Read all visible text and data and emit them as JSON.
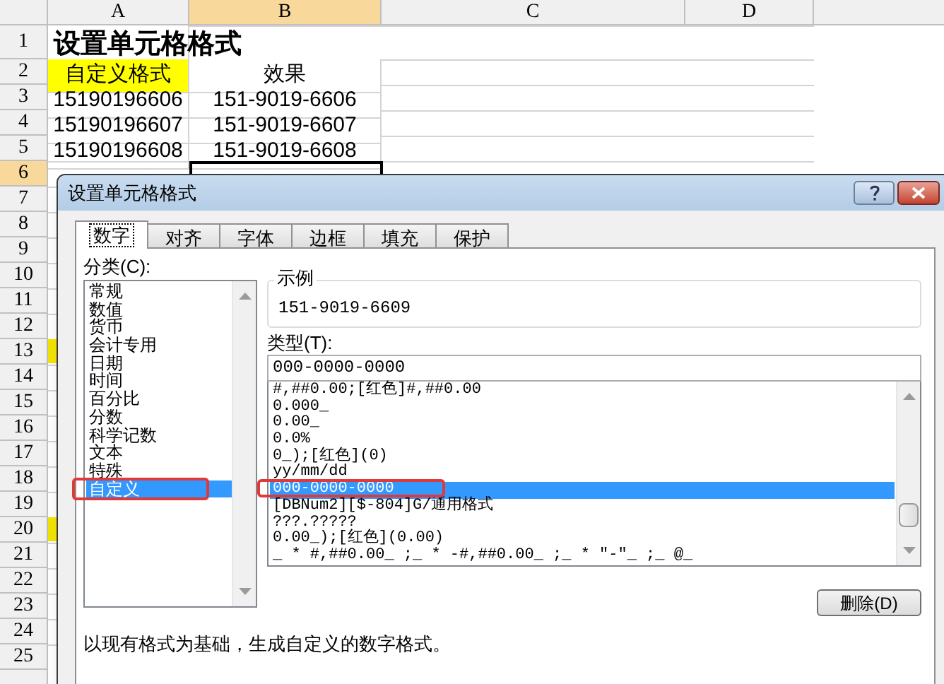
{
  "sheet": {
    "columns": [
      {
        "label": "A",
        "selected": false
      },
      {
        "label": "B",
        "selected": true
      },
      {
        "label": "C",
        "selected": false
      },
      {
        "label": "D",
        "selected": false
      }
    ],
    "rows": [
      {
        "number": "1",
        "selected": false,
        "marked": false,
        "cells": [
          "设置单元格格式"
        ],
        "kind": "title"
      },
      {
        "number": "2",
        "selected": false,
        "marked": false,
        "cells": [
          "自定义格式",
          "效果"
        ],
        "kind": "header"
      },
      {
        "number": "3",
        "selected": false,
        "marked": false,
        "cells": [
          "15190196606",
          "151-9019-6606"
        ],
        "kind": "data"
      },
      {
        "number": "4",
        "selected": false,
        "marked": false,
        "cells": [
          "15190196607",
          "151-9019-6607"
        ],
        "kind": "data"
      },
      {
        "number": "5",
        "selected": false,
        "marked": false,
        "cells": [
          "15190196608",
          "151-9019-6608"
        ],
        "kind": "data"
      },
      {
        "number": "6",
        "selected": true,
        "marked": false,
        "cells": [],
        "kind": "data"
      },
      {
        "number": "7",
        "selected": false,
        "marked": false,
        "cells": [],
        "kind": "data"
      },
      {
        "number": "8",
        "selected": false,
        "marked": false,
        "cells": [],
        "kind": "data"
      },
      {
        "number": "9",
        "selected": false,
        "marked": false,
        "cells": [],
        "kind": "data"
      },
      {
        "number": "10",
        "selected": false,
        "marked": false,
        "cells": [],
        "kind": "data"
      },
      {
        "number": "11",
        "selected": false,
        "marked": false,
        "cells": [],
        "kind": "data"
      },
      {
        "number": "12",
        "selected": false,
        "marked": false,
        "cells": [],
        "kind": "data"
      },
      {
        "number": "13",
        "selected": false,
        "marked": true,
        "cells": [],
        "kind": "data"
      },
      {
        "number": "14",
        "selected": false,
        "marked": false,
        "cells": [],
        "kind": "data"
      },
      {
        "number": "15",
        "selected": false,
        "marked": false,
        "cells": [],
        "kind": "data"
      },
      {
        "number": "16",
        "selected": false,
        "marked": false,
        "cells": [],
        "kind": "data"
      },
      {
        "number": "17",
        "selected": false,
        "marked": false,
        "cells": [],
        "kind": "data"
      },
      {
        "number": "18",
        "selected": false,
        "marked": false,
        "cells": [],
        "kind": "data"
      },
      {
        "number": "19",
        "selected": false,
        "marked": false,
        "cells": [],
        "kind": "data"
      },
      {
        "number": "20",
        "selected": false,
        "marked": true,
        "cells": [],
        "kind": "data"
      },
      {
        "number": "21",
        "selected": false,
        "marked": false,
        "cells": [],
        "kind": "data"
      },
      {
        "number": "22",
        "selected": false,
        "marked": false,
        "cells": [],
        "kind": "data"
      },
      {
        "number": "23",
        "selected": false,
        "marked": false,
        "cells": [],
        "kind": "data"
      },
      {
        "number": "24",
        "selected": false,
        "marked": false,
        "cells": [],
        "kind": "data"
      },
      {
        "number": "25",
        "selected": false,
        "marked": false,
        "cells": [],
        "kind": "data"
      }
    ]
  },
  "dialog": {
    "title": "设置单元格格式",
    "tabs": [
      {
        "label": "数字",
        "selected": true
      },
      {
        "label": "对齐",
        "selected": false
      },
      {
        "label": "字体",
        "selected": false
      },
      {
        "label": "边框",
        "selected": false
      },
      {
        "label": "填充",
        "selected": false
      },
      {
        "label": "保护",
        "selected": false
      }
    ],
    "category_label": "分类(C):",
    "categories": [
      {
        "label": "常规",
        "selected": false
      },
      {
        "label": "数值",
        "selected": false
      },
      {
        "label": "货币",
        "selected": false
      },
      {
        "label": "会计专用",
        "selected": false
      },
      {
        "label": "日期",
        "selected": false
      },
      {
        "label": "时间",
        "selected": false
      },
      {
        "label": "百分比",
        "selected": false
      },
      {
        "label": "分数",
        "selected": false
      },
      {
        "label": "科学记数",
        "selected": false
      },
      {
        "label": "文本",
        "selected": false
      },
      {
        "label": "特殊",
        "selected": false
      },
      {
        "label": "自定义",
        "selected": true
      }
    ],
    "sample": {
      "label": "示例",
      "value": "151-9019-6609"
    },
    "type_label": "类型(T):",
    "type_value": "000-0000-0000",
    "formats": [
      {
        "label": "#,##0.00;[红色]#,##0.00",
        "selected": false
      },
      {
        "label": "0.000_",
        "selected": false
      },
      {
        "label": "0.00_",
        "selected": false
      },
      {
        "label": "0.0%",
        "selected": false
      },
      {
        "label": "0_);[红色](0)",
        "selected": false
      },
      {
        "label": "yy/mm/dd",
        "selected": false
      },
      {
        "label": "000-0000-0000",
        "selected": true
      },
      {
        "label": "[DBNum2][$-804]G/通用格式",
        "selected": false
      },
      {
        "label": "???.?????",
        "selected": false
      },
      {
        "label": "0.00_);[红色](0.00)",
        "selected": false
      },
      {
        "label": "_ * #,##0.00_ ;_ * -#,##0.00_ ;_ * \"-\"_ ;_ @_",
        "selected": false
      }
    ],
    "delete_button": "删除(D)",
    "description": "以现有格式为基础，生成自定义的数字格式。"
  }
}
